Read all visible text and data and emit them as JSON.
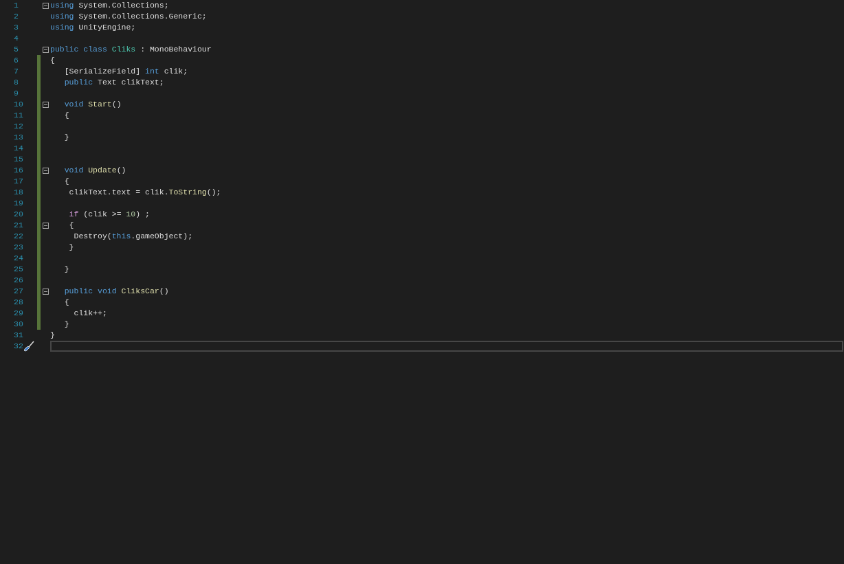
{
  "editor": {
    "lines": [
      {
        "number": "1",
        "fold": true,
        "tokens": [
          {
            "text": "using",
            "kind": "keyword"
          },
          {
            "text": " System.Collections;",
            "kind": "plain"
          }
        ]
      },
      {
        "number": "2",
        "tokens": [
          {
            "text": "using",
            "kind": "keyword"
          },
          {
            "text": " System.Collections.Generic;",
            "kind": "plain"
          }
        ]
      },
      {
        "number": "3",
        "tokens": [
          {
            "text": "using",
            "kind": "keyword"
          },
          {
            "text": " UnityEngine;",
            "kind": "plain"
          }
        ]
      },
      {
        "number": "4"
      },
      {
        "number": "5",
        "fold": true,
        "tokens": [
          {
            "text": "public class",
            "kind": "keyword"
          },
          {
            "text": " Cliks",
            "kind": "type"
          },
          {
            "text": " : MonoBehaviour",
            "kind": "plain"
          }
        ]
      },
      {
        "number": "6",
        "modified": true,
        "tokens": [
          {
            "text": "{",
            "kind": "plain"
          }
        ]
      },
      {
        "number": "7",
        "modified": true,
        "tokens": [
          {
            "text": "   [SerializeField] ",
            "kind": "plain"
          },
          {
            "text": "int",
            "kind": "keyword"
          },
          {
            "text": " clik;",
            "kind": "plain"
          }
        ]
      },
      {
        "number": "8",
        "modified": true,
        "tokens": [
          {
            "text": "   public",
            "kind": "keyword"
          },
          {
            "text": " Text clikText;",
            "kind": "plain"
          }
        ]
      },
      {
        "number": "9",
        "modified": true
      },
      {
        "number": "10",
        "fold": true,
        "modified": true,
        "tokens": [
          {
            "text": "   void",
            "kind": "keyword"
          },
          {
            "text": " Start",
            "kind": "method"
          },
          {
            "text": "()",
            "kind": "plain"
          }
        ]
      },
      {
        "number": "11",
        "modified": true,
        "tokens": [
          {
            "text": "   {",
            "kind": "plain"
          }
        ]
      },
      {
        "number": "12",
        "modified": true
      },
      {
        "number": "13",
        "modified": true,
        "tokens": [
          {
            "text": "   }",
            "kind": "plain"
          }
        ]
      },
      {
        "number": "14",
        "modified": true
      },
      {
        "number": "15",
        "modified": true
      },
      {
        "number": "16",
        "fold": true,
        "modified": true,
        "tokens": [
          {
            "text": "   void",
            "kind": "keyword"
          },
          {
            "text": " Update",
            "kind": "method"
          },
          {
            "text": "()",
            "kind": "plain"
          }
        ]
      },
      {
        "number": "17",
        "modified": true,
        "tokens": [
          {
            "text": "   {",
            "kind": "plain"
          }
        ]
      },
      {
        "number": "18",
        "modified": true,
        "tokens": [
          {
            "text": "    clikText.text = clik.",
            "kind": "plain"
          },
          {
            "text": "ToString",
            "kind": "method"
          },
          {
            "text": "();",
            "kind": "plain"
          }
        ]
      },
      {
        "number": "19",
        "modified": true
      },
      {
        "number": "20",
        "modified": true,
        "tokens": [
          {
            "text": "    if",
            "kind": "control"
          },
          {
            "text": " (clik >= ",
            "kind": "plain"
          },
          {
            "text": "10",
            "kind": "number"
          },
          {
            "text": ") ;",
            "kind": "plain"
          }
        ]
      },
      {
        "number": "21",
        "fold": true,
        "modified": true,
        "tokens": [
          {
            "text": "    {",
            "kind": "plain"
          }
        ]
      },
      {
        "number": "22",
        "modified": true,
        "tokens": [
          {
            "text": "     Destroy(",
            "kind": "plain"
          },
          {
            "text": "this",
            "kind": "keyword"
          },
          {
            "text": ".gameObject);",
            "kind": "plain"
          }
        ]
      },
      {
        "number": "23",
        "modified": true,
        "tokens": [
          {
            "text": "    }",
            "kind": "plain"
          }
        ]
      },
      {
        "number": "24",
        "modified": true
      },
      {
        "number": "25",
        "modified": true,
        "tokens": [
          {
            "text": "   }",
            "kind": "plain"
          }
        ]
      },
      {
        "number": "26",
        "modified": true
      },
      {
        "number": "27",
        "fold": true,
        "modified": true,
        "tokens": [
          {
            "text": "   public void",
            "kind": "keyword"
          },
          {
            "text": " CliksCar",
            "kind": "method"
          },
          {
            "text": "()",
            "kind": "plain"
          }
        ]
      },
      {
        "number": "28",
        "modified": true,
        "tokens": [
          {
            "text": "   {",
            "kind": "plain"
          }
        ]
      },
      {
        "number": "29",
        "modified": true,
        "tokens": [
          {
            "text": "     clik++;",
            "kind": "plain"
          }
        ]
      },
      {
        "number": "30",
        "modified": true,
        "tokens": [
          {
            "text": "   }",
            "kind": "plain"
          }
        ]
      },
      {
        "number": "31",
        "tokens": [
          {
            "text": "}",
            "kind": "plain"
          }
        ]
      },
      {
        "number": "32",
        "current": true
      }
    ]
  }
}
